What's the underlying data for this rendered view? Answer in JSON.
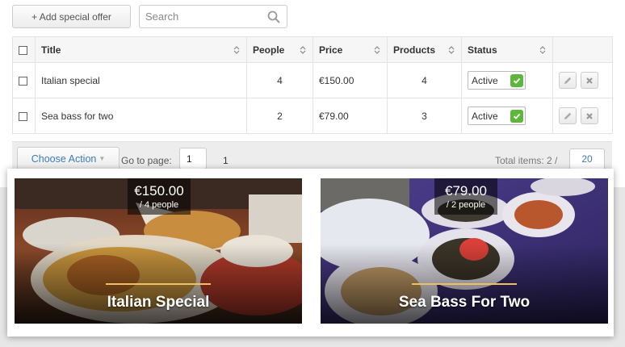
{
  "toolbar": {
    "add_label": "+ Add special offer",
    "search_placeholder": "Search"
  },
  "table": {
    "headers": {
      "title": "Title",
      "people": "People",
      "price": "Price",
      "products": "Products",
      "status": "Status"
    },
    "rows": [
      {
        "title": "Italian special",
        "people": "4",
        "price": "€150.00",
        "products": "4",
        "status": "Active"
      },
      {
        "title": "Sea bass for two",
        "people": "2",
        "price": "€79.00",
        "products": "3",
        "status": "Active"
      }
    ]
  },
  "footer": {
    "choose_action": "Choose Action",
    "goto_label": "Go to page:",
    "page_value": "1",
    "total_pages": "1",
    "total_items": "Total items: 2 /",
    "per_page": "20"
  },
  "preview": {
    "cards": [
      {
        "price": "€150.00",
        "people": "/ 4 people",
        "title": "Italian Special"
      },
      {
        "price": "€79.00",
        "people": "/ 2 people",
        "title": "Sea Bass For Two"
      }
    ]
  },
  "colors": {
    "accent": "#3d7bb5",
    "active_check": "#5fb63c",
    "card_rule": "#f0c060"
  }
}
